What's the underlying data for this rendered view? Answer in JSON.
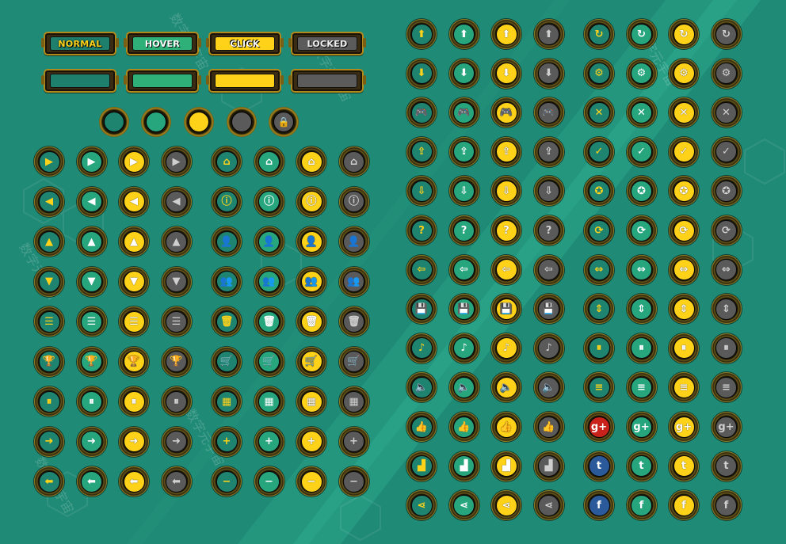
{
  "palette": {
    "background": "#1f8a75",
    "normal": "#1e8470",
    "hover": "#27a57d",
    "click": "#ffd21a",
    "locked": "#5a5a5a",
    "frame": "#a8871c"
  },
  "state_buttons": {
    "normal_label": "NORMAL",
    "hover_label": "HOVER",
    "click_label": "CLICK",
    "locked_label": "LOCKED"
  },
  "states": [
    "normal",
    "hover",
    "click",
    "locked"
  ],
  "left_icon_column_a": [
    "play",
    "back",
    "up",
    "down",
    "list",
    "trophy",
    "pause",
    "arrow-right",
    "arrow-left"
  ],
  "left_icon_column_b": [
    "home",
    "info",
    "user",
    "users",
    "trash",
    "cart",
    "grid",
    "plus",
    "minus"
  ],
  "right_icon_column_a": [
    "arrow-up",
    "arrow-down",
    "gamepad",
    "upload",
    "download",
    "help",
    "exit",
    "save",
    "music",
    "sound",
    "like",
    "leaderboard",
    "share"
  ],
  "right_icon_column_b": [
    "refresh",
    "settings",
    "close",
    "check",
    "achievement",
    "restart",
    "horizontal-arrows",
    "vertical-arrows",
    "pause-bars",
    "menu",
    "google-plus",
    "twitter",
    "facebook"
  ],
  "glyphs": {
    "play": "▶",
    "back": "◀",
    "up": "▲",
    "down": "▼",
    "list": "☰",
    "trophy": "🏆",
    "pause": "⏸",
    "arrow-right": "➜",
    "arrow-left": "⬅",
    "home": "⌂",
    "info": "ⓘ",
    "user": "👤",
    "users": "👥",
    "trash": "🗑",
    "cart": "🛒",
    "grid": "▦",
    "plus": "+",
    "minus": "−",
    "arrow-up": "⬆",
    "arrow-down": "⬇",
    "gamepad": "🎮",
    "upload": "⇪",
    "download": "⇩",
    "help": "?",
    "exit": "⇦",
    "save": "💾",
    "music": "♪",
    "sound": "🔈",
    "like": "👍",
    "leaderboard": "▟",
    "share": "⋖",
    "refresh": "↻",
    "settings": "⚙",
    "close": "✕",
    "check": "✓",
    "achievement": "✪",
    "restart": "⟳",
    "horizontal-arrows": "⇔",
    "vertical-arrows": "⇕",
    "pause-bars": "⏸",
    "menu": "≡",
    "google-plus": "g+",
    "twitter": "t",
    "facebook": "f",
    "lock": "🔒"
  },
  "watermarks": [
    "数字元宇宙",
    "数字元宇宙",
    "数字元宇宙",
    "数字元宇宙",
    "数字元宇宙",
    "数字元宇宙"
  ]
}
